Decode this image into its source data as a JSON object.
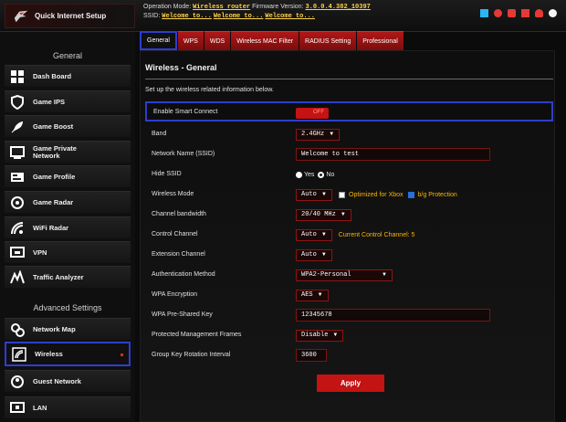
{
  "brand": {
    "title": "Quick Internet Setup"
  },
  "header": {
    "op_mode_label": "Operation Mode:",
    "op_mode_value": "Wireless router",
    "fw_label": "Firmware Version:",
    "fw_value": "3.0.0.4.382_10397",
    "ssid_label": "SSID:",
    "ssid_values": [
      "Welcome to...",
      "Welcome to...",
      "Welcome to..."
    ]
  },
  "sidebar": {
    "general_title": "General",
    "advanced_title": "Advanced Settings",
    "items": [
      {
        "label": "Dash Board",
        "icon": "dashboard-icon"
      },
      {
        "label": "Game IPS",
        "icon": "shield-icon"
      },
      {
        "label": "Game Boost",
        "icon": "rocket-icon"
      },
      {
        "label": "Game Private Network",
        "icon": "monitor-icon"
      },
      {
        "label": "Game Profile",
        "icon": "profile-icon"
      },
      {
        "label": "Game Radar",
        "icon": "radar-icon"
      },
      {
        "label": "WiFi Radar",
        "icon": "wifi-radar-icon"
      },
      {
        "label": "VPN",
        "icon": "vpn-icon"
      },
      {
        "label": "Traffic Analyzer",
        "icon": "traffic-icon"
      }
    ],
    "advanced_items": [
      {
        "label": "Network Map",
        "icon": "network-map-icon"
      },
      {
        "label": "Wireless",
        "icon": "wireless-icon"
      },
      {
        "label": "Guest Network",
        "icon": "guest-icon"
      },
      {
        "label": "LAN",
        "icon": "lan-icon"
      }
    ]
  },
  "tabs": [
    "General",
    "WPS",
    "WDS",
    "Wireless MAC Filter",
    "RADIUS Setting",
    "Professional"
  ],
  "page": {
    "title": "Wireless - General",
    "description": "Set up the wireless related information below."
  },
  "form": {
    "smart_connect": {
      "label": "Enable Smart Connect",
      "state": "OFF"
    },
    "band": {
      "label": "Band",
      "value": "2.4GHz"
    },
    "ssid": {
      "label": "Network Name (SSID)",
      "value": "Welcome to test"
    },
    "hide_ssid": {
      "label": "Hide SSID",
      "yes": "Yes",
      "no": "No"
    },
    "wireless_mode": {
      "label": "Wireless Mode",
      "value": "Auto",
      "xbox_label": "Optimized for Xbox",
      "bg_label": "b/g Protection"
    },
    "bandwidth": {
      "label": "Channel bandwidth",
      "value": "20/40 MHz"
    },
    "control_channel": {
      "label": "Control Channel",
      "value": "Auto",
      "hint": "Current Control Channel: 5"
    },
    "extension_channel": {
      "label": "Extension Channel",
      "value": "Auto"
    },
    "auth_method": {
      "label": "Authentication Method",
      "value": "WPA2-Personal"
    },
    "wpa_encryption": {
      "label": "WPA Encryption",
      "value": "AES"
    },
    "psk": {
      "label": "WPA Pre-Shared Key",
      "value": "12345678"
    },
    "pmf": {
      "label": "Protected Management Frames",
      "value": "Disable"
    },
    "gk_interval": {
      "label": "Group Key Rotation Interval",
      "value": "3600"
    }
  },
  "apply_label": "Apply",
  "colors": {
    "accent": "#c31313",
    "highlight": "#2d3ecf",
    "hint": "#ffb400"
  }
}
